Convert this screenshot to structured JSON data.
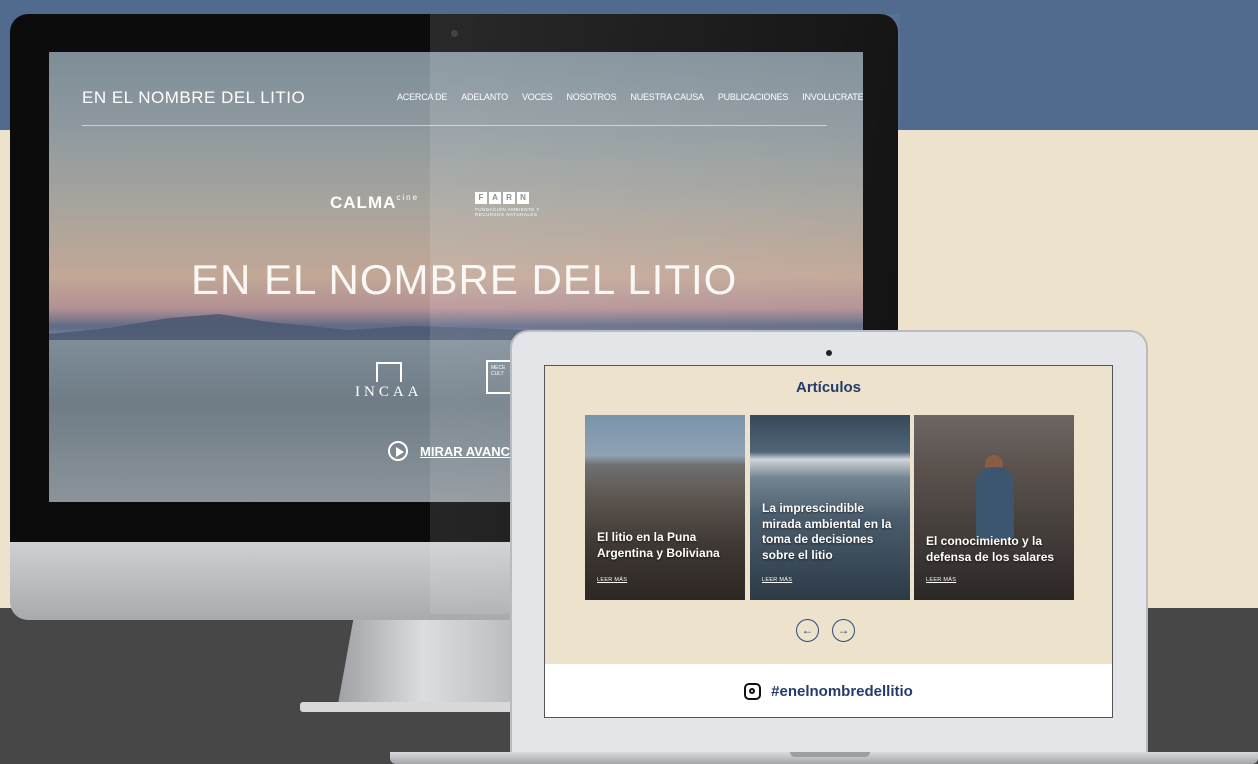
{
  "desktop_site": {
    "logo": "EN EL NOMBRE DEL LITIO",
    "nav": [
      "ACERCA DE",
      "ADELANTO",
      "VOCES",
      "NOSOTROS",
      "NUESTRA CAUSA",
      "PUBLICACIONES",
      "INVOLUCRATE"
    ],
    "partner_logos": {
      "calma": "CALMA",
      "calma_sup": "cine",
      "farn_letters": [
        "F",
        "A",
        "R",
        "N"
      ],
      "farn_tagline": "FUNDACIÓN AMBIENTE Y RECURSOS NATURALES",
      "incaa": "INCAA",
      "second": "MECE CULT"
    },
    "hero_title": "EN EL NOMBRE DEL LITIO",
    "watch_button": "MIRAR AVANC"
  },
  "laptop_site": {
    "section_title": "Artículos",
    "articles": [
      {
        "title": "El litio en la Puna Argentina y Boliviana",
        "link": "LEER MÁS"
      },
      {
        "title": "La imprescindible mirada ambiental en la toma de decisiones sobre el litio",
        "link": "LEER MÁS"
      },
      {
        "title": "El conocimiento y la defensa de los salares",
        "link": "LEER MÁS"
      }
    ],
    "prev_arrow": "←",
    "next_arrow": "→",
    "instagram_hashtag": "#enelnombredellitio"
  },
  "colors": {
    "top_band": "#506b8d",
    "cream": "#ede3cc",
    "bottom_band": "#474748",
    "accent_navy": "#243c6b"
  },
  "icons": [
    "play-icon",
    "arrow-left-icon",
    "arrow-right-icon",
    "instagram-icon"
  ]
}
